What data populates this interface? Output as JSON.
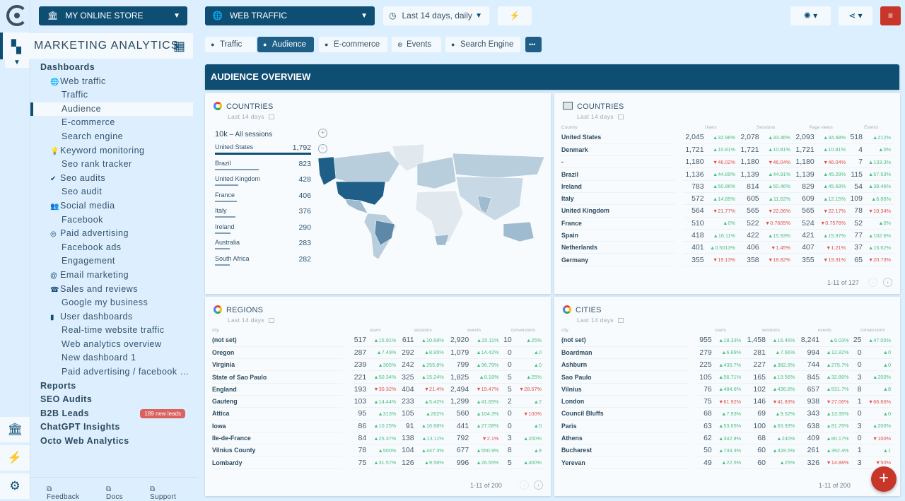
{
  "app": {
    "store_name": "MY ONLINE STORE",
    "section_title": "MARKETING ANALYTICS"
  },
  "colors": {
    "primary": "#0f4e73",
    "accent_red": "#c8362a",
    "positive": "#4cbf82",
    "negative": "#e0524a",
    "badge": "#d9625e"
  },
  "rail": {
    "icons": [
      "logo-icon",
      "dashboard-icon",
      "bank-icon",
      "plug-icon",
      "gear-icon"
    ]
  },
  "sidebar": {
    "items": [
      {
        "label": "Dashboards",
        "level": 0
      },
      {
        "label": "Web traffic",
        "level": 1,
        "icon": "globe-icon"
      },
      {
        "label": "Traffic",
        "level": 2
      },
      {
        "label": "Audience",
        "level": 2,
        "active": true
      },
      {
        "label": "E-commerce",
        "level": 2
      },
      {
        "label": "Search engine",
        "level": 2
      },
      {
        "label": "Keyword monitoring",
        "level": 1,
        "icon": "bulb-icon"
      },
      {
        "label": "Seo rank tracker",
        "level": 2
      },
      {
        "label": "Seo audits",
        "level": 1,
        "icon": "check-icon"
      },
      {
        "label": "Seo audit",
        "level": 2
      },
      {
        "label": "Social media",
        "level": 1,
        "icon": "people-icon"
      },
      {
        "label": "Facebook",
        "level": 2
      },
      {
        "label": "Paid advertising",
        "level": 1,
        "icon": "target-icon"
      },
      {
        "label": "Facebook ads",
        "level": 2
      },
      {
        "label": "Engagement",
        "level": 2
      },
      {
        "label": "Email marketing",
        "level": 1,
        "icon": "at-icon"
      },
      {
        "label": "Sales and reviews",
        "level": 1,
        "icon": "phone-icon"
      },
      {
        "label": "Google my business",
        "level": 2
      },
      {
        "label": "User dashboards",
        "level": 1,
        "icon": "file-icon"
      },
      {
        "label": "Real-time website traffic",
        "level": 2
      },
      {
        "label": "Web analytics overview",
        "level": 2
      },
      {
        "label": "New dashboard 1",
        "level": 2
      },
      {
        "label": "Paid advertising / facebook …",
        "level": 2
      },
      {
        "label": "Reports",
        "level": 0
      },
      {
        "label": "SEO Audits",
        "level": 0
      },
      {
        "label": "B2B Leads",
        "level": 0,
        "badge": "189 new leads"
      },
      {
        "label": "ChatGPT Insights",
        "level": 0
      },
      {
        "label": "Octo Web Analytics",
        "level": 0
      }
    ],
    "footer": {
      "feedback": "Feedback",
      "docs": "Docs",
      "support": "Support"
    }
  },
  "topbar": {
    "dashboard_select": "WEB TRAFFIC",
    "date_range": "Last 14 days, daily"
  },
  "tabs": [
    {
      "label": "Traffic",
      "icon": "check-circle"
    },
    {
      "label": "Audience",
      "icon": "check-circle",
      "active": true
    },
    {
      "label": "E-commerce",
      "icon": "check-circle"
    },
    {
      "label": "Events",
      "icon": "plus-circle"
    },
    {
      "label": "Search Engine",
      "icon": "check-circle"
    }
  ],
  "more_label": "•••",
  "overview_title": "AUDIENCE OVERVIEW",
  "countries_map": {
    "title": "COUNTRIES",
    "subtitle": "Last 14 days",
    "total_value": "10k",
    "total_label": " – All sessions",
    "rows": [
      {
        "name": "United States",
        "value": "1,792",
        "share": 1.0
      },
      {
        "name": "Brazil",
        "value": "823",
        "share": 0.459
      },
      {
        "name": "United Kingdom",
        "value": "428",
        "share": 0.239
      },
      {
        "name": "France",
        "value": "406",
        "share": 0.227
      },
      {
        "name": "Italy",
        "value": "376",
        "share": 0.21
      },
      {
        "name": "Ireland",
        "value": "290",
        "share": 0.162
      },
      {
        "name": "Australia",
        "value": "283",
        "share": 0.158
      },
      {
        "name": "South Africa",
        "value": "282",
        "share": 0.157
      }
    ]
  },
  "countries_table": {
    "title": "COUNTRIES",
    "subtitle": "Last 14 days",
    "columns": [
      "Country",
      "Users",
      "Sessions",
      "Page views",
      "Events"
    ],
    "rows": [
      [
        "United States",
        "2,045",
        "▲32.96%",
        "2,078",
        "▲33.46%",
        "2,093",
        "▲34.68%",
        "518",
        "▲212%"
      ],
      [
        "Denmark",
        "1,721",
        "▲10.81%",
        "1,721",
        "▲10.81%",
        "1,721",
        "▲10.81%",
        "4",
        "▲0%"
      ],
      [
        "-",
        "1,180",
        "▼46.02%",
        "1,180",
        "▼46.04%",
        "1,180",
        "▼46.04%",
        "7",
        "▲133.3%"
      ],
      [
        "Brazil",
        "1,136",
        "▲44.89%",
        "1,139",
        "▲44.91%",
        "1,139",
        "▲45.28%",
        "115",
        "▲57.53%"
      ],
      [
        "Ireland",
        "783",
        "▲50.86%",
        "814",
        "▲50.46%",
        "829",
        "▲45.69%",
        "54",
        "▲38.46%"
      ],
      [
        "Italy",
        "572",
        "▲14.85%",
        "605",
        "▲11.62%",
        "609",
        "▲12.15%",
        "109",
        "▲6.86%"
      ],
      [
        "United Kingdom",
        "564",
        "▼21.77%",
        "565",
        "▼22.06%",
        "565",
        "▼22.17%",
        "78",
        "▼10.34%"
      ],
      [
        "France",
        "510",
        "▲0%",
        "522",
        "▼0.7605%",
        "524",
        "▼0.7576%",
        "52",
        "▲0%"
      ],
      [
        "Spain",
        "418",
        "▲16.11%",
        "422",
        "▲15.93%",
        "421",
        "▲15.97%",
        "77",
        "▲102.6%"
      ],
      [
        "Netherlands",
        "401",
        "▲0.5013%",
        "406",
        "▼1.45%",
        "407",
        "▼1.21%",
        "37",
        "▲15.62%"
      ],
      [
        "Germany",
        "355",
        "▼19.13%",
        "358",
        "▼18.82%",
        "355",
        "▼19.31%",
        "65",
        "▼20.73%"
      ]
    ],
    "pagination": "1-11 of 127"
  },
  "regions_table": {
    "title": "REGIONS",
    "subtitle": "Last 14 days",
    "columns": [
      "city",
      "users",
      "sessions",
      "events",
      "conversions"
    ],
    "rows": [
      [
        "(not set)",
        "517",
        "▲15.91%",
        "611",
        "▲10.68%",
        "2,920",
        "▲20.11%",
        "10",
        "▲25%"
      ],
      [
        "Oregon",
        "287",
        "▲7.49%",
        "292",
        "▲8.95%",
        "1,079",
        "▲14.42%",
        "0",
        "▲0"
      ],
      [
        "Virginia",
        "239",
        "▲305%",
        "242",
        "▲255.8%",
        "799",
        "▲96.79%",
        "0",
        "▲0"
      ],
      [
        "State of Sao Paulo",
        "221",
        "▲50.34%",
        "325",
        "▲15.24%",
        "1,825",
        "▲8.18%",
        "5",
        "▲25%"
      ],
      [
        "England",
        "193",
        "▼30.32%",
        "404",
        "▼21.4%",
        "2,494",
        "▼19.47%",
        "5",
        "▼28.57%"
      ],
      [
        "Gauteng",
        "103",
        "▲14.44%",
        "233",
        "▲5.42%",
        "1,299",
        "▲41.65%",
        "2",
        "▲2"
      ],
      [
        "Attica",
        "95",
        "▲313%",
        "105",
        "▲262%",
        "560",
        "▲104.3%",
        "0",
        "▼100%"
      ],
      [
        "Iowa",
        "86",
        "▲10.25%",
        "91",
        "▲16.66%",
        "441",
        "▲27.08%",
        "0",
        "▲0"
      ],
      [
        "Ile-de-France",
        "84",
        "▲25.37%",
        "138",
        "▲13.11%",
        "792",
        "▼2.1%",
        "3",
        "▲200%"
      ],
      [
        "Vilnius County",
        "78",
        "▲500%",
        "104",
        "▲447.3%",
        "677",
        "▲550.9%",
        "8",
        "▲8"
      ],
      [
        "Lombardy",
        "75",
        "▲31.57%",
        "126",
        "▲9.56%",
        "996",
        "▲26.55%",
        "5",
        "▲400%"
      ]
    ],
    "pagination": "1-11 of 200"
  },
  "cities_table": {
    "title": "CITIES",
    "subtitle": "Last 14 days",
    "columns": [
      "city",
      "users",
      "sessions",
      "events",
      "conversions"
    ],
    "rows": [
      [
        "(not set)",
        "955",
        "▲18.33%",
        "1,458",
        "▲16.45%",
        "8,241",
        "▲9.03%",
        "25",
        "▲47.05%"
      ],
      [
        "Boardman",
        "279",
        "▲6.89%",
        "281",
        "▲7.66%",
        "994",
        "▲12.82%",
        "0",
        "▲0"
      ],
      [
        "Ashburn",
        "225",
        "▲435.7%",
        "227",
        "▲382.9%",
        "744",
        "▲275.7%",
        "0",
        "▲0"
      ],
      [
        "Sao Paulo",
        "105",
        "▲56.71%",
        "165",
        "▲19.56%",
        "845",
        "▲32.86%",
        "3",
        "▲200%"
      ],
      [
        "Vilnius",
        "76",
        "▲484.6%",
        "102",
        "▲436.8%",
        "657",
        "▲531.7%",
        "8",
        "▲8"
      ],
      [
        "London",
        "75",
        "▼61.92%",
        "146",
        "▼41.83%",
        "938",
        "▼27.06%",
        "1",
        "▼66.66%"
      ],
      [
        "Council Bluffs",
        "68",
        "▲7.93%",
        "69",
        "▲9.52%",
        "343",
        "▲13.95%",
        "0",
        "▲0"
      ],
      [
        "Paris",
        "63",
        "▲53.65%",
        "100",
        "▲63.93%",
        "638",
        "▲81.76%",
        "3",
        "▲200%"
      ],
      [
        "Athens",
        "62",
        "▲342.8%",
        "68",
        "▲240%",
        "409",
        "▲80.17%",
        "0",
        "▼100%"
      ],
      [
        "Bucharest",
        "50",
        "▲733.3%",
        "60",
        "▲328.5%",
        "261",
        "▲392.4%",
        "1",
        "▲1"
      ],
      [
        "Yerevan",
        "49",
        "▲22.5%",
        "60",
        "▲25%",
        "326",
        "▼14.88%",
        "3",
        "▼50%"
      ]
    ],
    "pagination": "1-11 of 200"
  },
  "fab_label": "+"
}
